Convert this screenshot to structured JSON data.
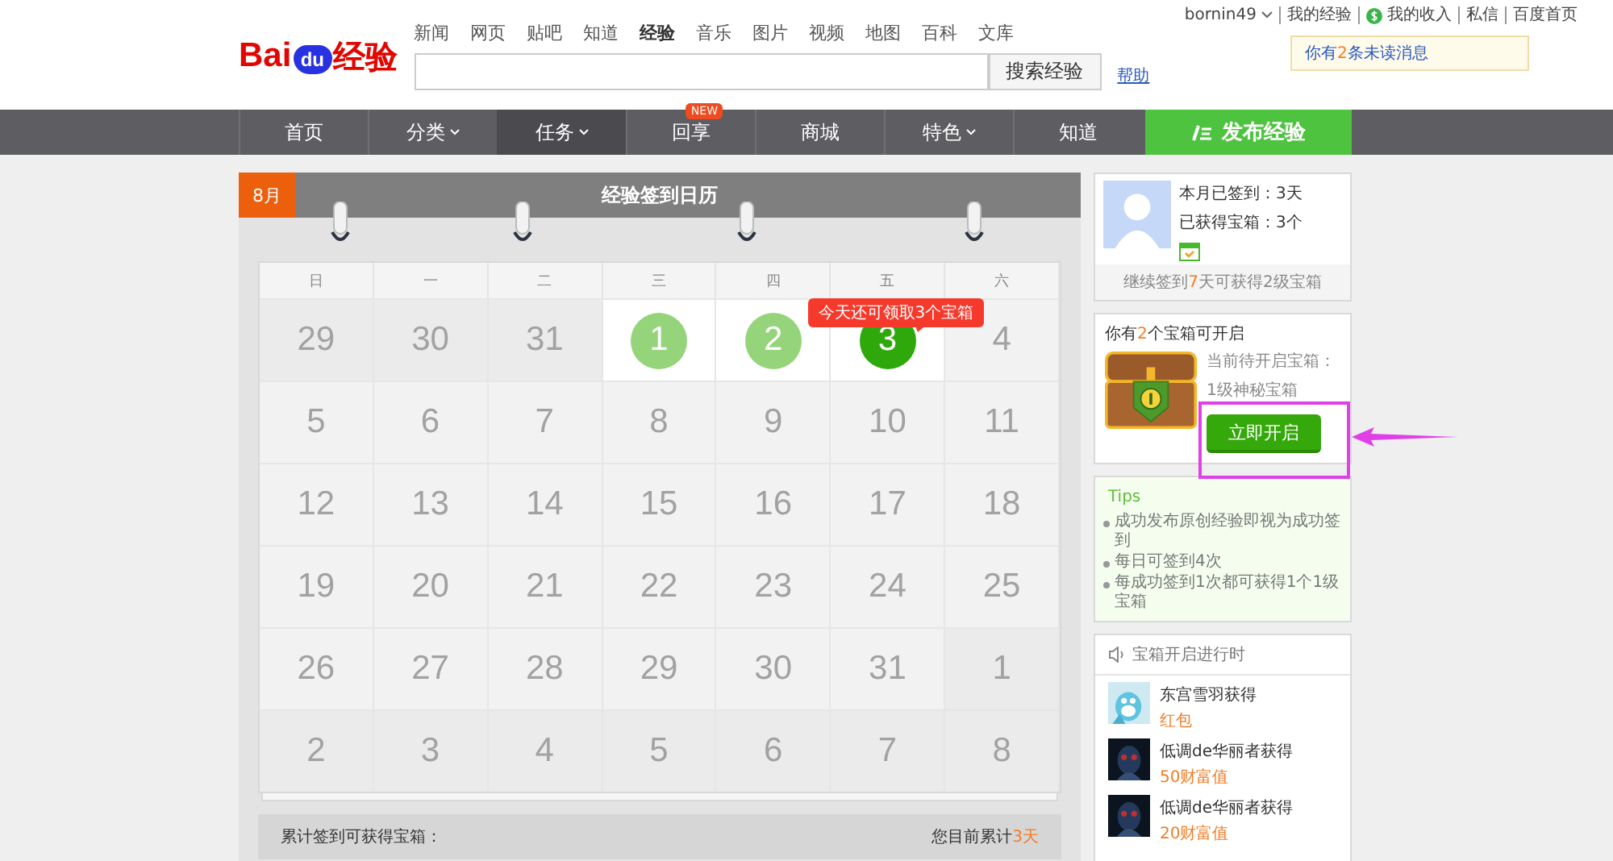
{
  "user_bar": {
    "username": "bornin49",
    "links": [
      {
        "label": "我的经验",
        "icon": false
      },
      {
        "label": "我的收入",
        "icon": true
      },
      {
        "label": "私信",
        "icon": false
      },
      {
        "label": "百度首页",
        "icon": false
      }
    ],
    "notice": [
      {
        "text": "你有",
        "highlight": false
      },
      {
        "text": "2",
        "highlight": true
      },
      {
        "text": "条未读消息",
        "highlight": false
      }
    ]
  },
  "logo": {
    "text_left": "Bai",
    "text_paw": "du",
    "text_right": "经验"
  },
  "product_links": [
    {
      "label": "新闻",
      "selected": false
    },
    {
      "label": "网页",
      "selected": false
    },
    {
      "label": "贴吧",
      "selected": false
    },
    {
      "label": "知道",
      "selected": false
    },
    {
      "label": "经验",
      "selected": true
    },
    {
      "label": "音乐",
      "selected": false
    },
    {
      "label": "图片",
      "selected": false
    },
    {
      "label": "视频",
      "selected": false
    },
    {
      "label": "地图",
      "selected": false
    },
    {
      "label": "百科",
      "selected": false
    },
    {
      "label": "文库",
      "selected": false
    }
  ],
  "search": {
    "button": "搜索经验",
    "help": "帮助"
  },
  "nav": [
    {
      "label": "首页",
      "selected": false,
      "dropdown": false
    },
    {
      "label": "分类",
      "selected": false,
      "dropdown": true
    },
    {
      "label": "任务",
      "selected": true,
      "dropdown": true
    },
    {
      "label": "回享",
      "selected": false,
      "dropdown": false,
      "badge": "NEW"
    },
    {
      "label": "商城",
      "selected": false,
      "dropdown": false
    },
    {
      "label": "特色",
      "selected": false,
      "dropdown": true
    },
    {
      "label": "知道",
      "selected": false,
      "dropdown": false
    }
  ],
  "publish_button": "发布经验",
  "calendar": {
    "month": "8月",
    "title": "经验签到日历",
    "weekdays": [
      "日",
      "一",
      "二",
      "三",
      "四",
      "五",
      "六"
    ],
    "weeks": [
      [
        {
          "day": "29",
          "kind": "other"
        },
        {
          "day": "30",
          "kind": "other"
        },
        {
          "day": "31",
          "kind": "other"
        },
        {
          "day": "1",
          "kind": "signed"
        },
        {
          "day": "2",
          "kind": "signed"
        },
        {
          "day": "3",
          "kind": "today",
          "tooltip": "今天还可领取3个宝箱"
        },
        {
          "day": "4",
          "kind": "plain"
        }
      ],
      [
        {
          "day": "5",
          "kind": "plain"
        },
        {
          "day": "6",
          "kind": "plain"
        },
        {
          "day": "7",
          "kind": "plain"
        },
        {
          "day": "8",
          "kind": "plain"
        },
        {
          "day": "9",
          "kind": "plain"
        },
        {
          "day": "10",
          "kind": "plain"
        },
        {
          "day": "11",
          "kind": "plain"
        }
      ],
      [
        {
          "day": "12",
          "kind": "plain"
        },
        {
          "day": "13",
          "kind": "plain"
        },
        {
          "day": "14",
          "kind": "plain"
        },
        {
          "day": "15",
          "kind": "plain"
        },
        {
          "day": "16",
          "kind": "plain"
        },
        {
          "day": "17",
          "kind": "plain"
        },
        {
          "day": "18",
          "kind": "plain"
        }
      ],
      [
        {
          "day": "19",
          "kind": "plain"
        },
        {
          "day": "20",
          "kind": "plain"
        },
        {
          "day": "21",
          "kind": "plain"
        },
        {
          "day": "22",
          "kind": "plain"
        },
        {
          "day": "23",
          "kind": "plain"
        },
        {
          "day": "24",
          "kind": "plain"
        },
        {
          "day": "25",
          "kind": "plain"
        }
      ],
      [
        {
          "day": "26",
          "kind": "plain"
        },
        {
          "day": "27",
          "kind": "plain"
        },
        {
          "day": "28",
          "kind": "plain"
        },
        {
          "day": "29",
          "kind": "plain"
        },
        {
          "day": "30",
          "kind": "plain"
        },
        {
          "day": "31",
          "kind": "plain"
        },
        {
          "day": "1",
          "kind": "other"
        }
      ],
      [
        {
          "day": "2",
          "kind": "other"
        },
        {
          "day": "3",
          "kind": "other"
        },
        {
          "day": "4",
          "kind": "other"
        },
        {
          "day": "5",
          "kind": "other"
        },
        {
          "day": "6",
          "kind": "other"
        },
        {
          "day": "7",
          "kind": "other"
        },
        {
          "day": "8",
          "kind": "other"
        }
      ]
    ],
    "footer_left": "累计签到可获得宝箱：",
    "footer_right": [
      {
        "text": "您目前累计",
        "highlight": false
      },
      {
        "text": "3天",
        "highlight": true
      }
    ]
  },
  "profile": {
    "lines": [
      "本月已签到：3天",
      "已获得宝箱：3个"
    ],
    "hint": [
      {
        "text": "继续签到",
        "highlight": false
      },
      {
        "text": "7",
        "highlight": true
      },
      {
        "text": "天可获得2级宝箱",
        "highlight": false
      }
    ]
  },
  "chest": {
    "title": [
      {
        "text": "你有",
        "highlight": false
      },
      {
        "text": "2",
        "highlight": true
      },
      {
        "text": "个宝箱可开启",
        "highlight": false
      }
    ],
    "current_label": "当前待开启宝箱：",
    "current_name": "1级神秘宝箱",
    "button": "立即开启"
  },
  "tips": {
    "title": "Tips",
    "items": [
      "成功发布原创经验即视为成功签到",
      "每日可签到4次",
      "每成功签到1次都可获得1个1级宝箱"
    ]
  },
  "feed": {
    "title": "宝箱开启进行时",
    "items": [
      {
        "name": "东宫雪羽获得",
        "reward": "红包"
      },
      {
        "name": "低调de华丽者获得",
        "reward": "50财富值"
      },
      {
        "name": "低调de华丽者获得",
        "reward": "20财富值"
      }
    ]
  }
}
